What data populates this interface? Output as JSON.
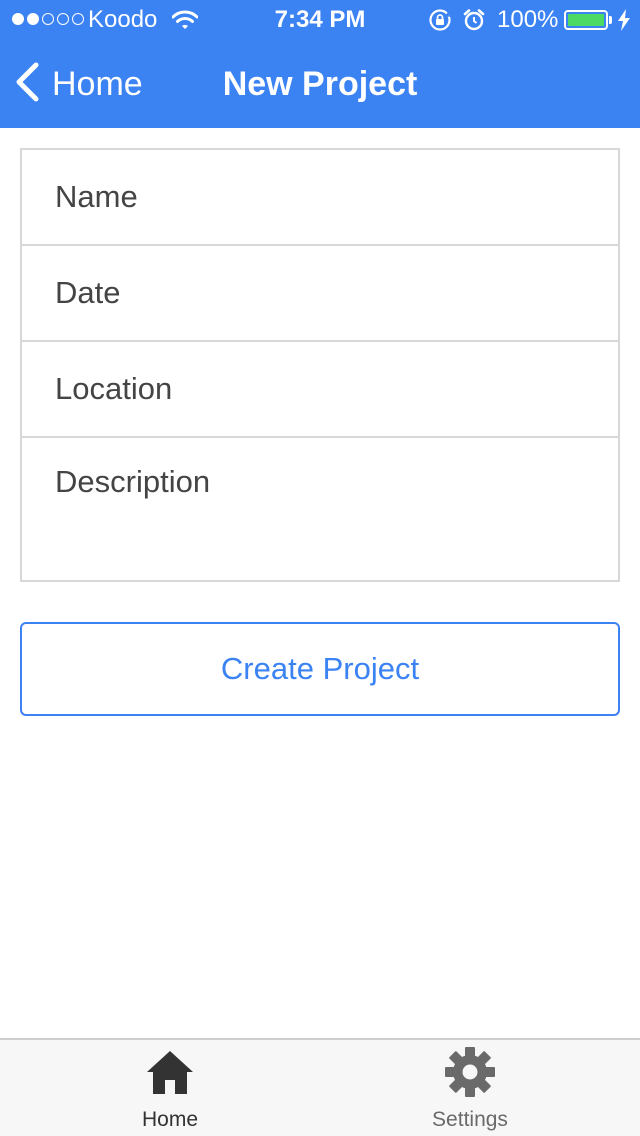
{
  "status_bar": {
    "carrier": "Koodo",
    "time": "7:34 PM",
    "battery_percent": "100%",
    "signal_bars_filled": 2,
    "signal_bars_total": 5,
    "battery_level": 1.0
  },
  "nav": {
    "back_label": "Home",
    "title": "New Project",
    "color": "#3b82f3"
  },
  "form": {
    "name_placeholder": "Name",
    "date_placeholder": "Date",
    "location_placeholder": "Location",
    "description_placeholder": "Description",
    "name_value": "",
    "date_value": "",
    "location_value": "",
    "description_value": ""
  },
  "create_button": {
    "label": "Create Project",
    "color": "#3b82f3"
  },
  "tab_bar": {
    "tabs": [
      {
        "label": "Home",
        "icon": "home-icon",
        "active": true,
        "color": "#333333"
      },
      {
        "label": "Settings",
        "icon": "gear-icon",
        "active": false,
        "color": "#6a6a6a"
      }
    ]
  }
}
